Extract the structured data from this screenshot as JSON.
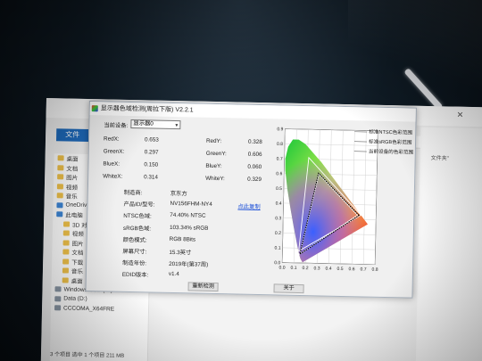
{
  "window": {
    "title": "显示器色域检测(周拉下版) V2.2.1",
    "monitor_label": "当前设备:",
    "monitor_value": "显示器0"
  },
  "coords": [
    {
      "label": "RedX:",
      "value": "0.653"
    },
    {
      "label": "RedY:",
      "value": "0.328"
    },
    {
      "label": "GreenX:",
      "value": "0.297"
    },
    {
      "label": "GreenY:",
      "value": "0.606"
    },
    {
      "label": "BlueX:",
      "value": "0.150"
    },
    {
      "label": "BlueY:",
      "value": "0.060"
    },
    {
      "label": "WhiteX:",
      "value": "0.314"
    },
    {
      "label": "WhiteY:",
      "value": "0.329"
    }
  ],
  "info": [
    {
      "label": "制造商:",
      "value": "京东方"
    },
    {
      "label": "产品ID/型号:",
      "value": "NV156FHM-NY4",
      "link": "点此复制"
    },
    {
      "label": "NTSC色域:",
      "value": "74.40% NTSC"
    },
    {
      "label": "sRGB色域:",
      "value": "103.34% sRGB"
    },
    {
      "label": "颜色模式:",
      "value": "RGB 8Bits"
    },
    {
      "label": "屏幕尺寸:",
      "value": "15.3英寸"
    },
    {
      "label": "制造年份:",
      "value": "2019年(第37周)"
    },
    {
      "label": "EDID版本:",
      "value": "v1.4"
    }
  ],
  "buttons": {
    "redetect": "重新检测",
    "close": "关于"
  },
  "legend": [
    "标准NTSC色彩范围",
    "标准sRGB色彩范围",
    "当前设备的色彩范围"
  ],
  "chart_data": {
    "type": "scatter",
    "title": "",
    "xlim": [
      0.0,
      0.8
    ],
    "ylim": [
      0.0,
      0.9
    ],
    "x_ticks": [
      "0.0",
      "0.1",
      "0.2",
      "0.3",
      "0.4",
      "0.5",
      "0.6",
      "0.7",
      "0.8"
    ],
    "y_ticks": [
      "0.0",
      "0.1",
      "0.2",
      "0.3",
      "0.4",
      "0.5",
      "0.6",
      "0.7",
      "0.8",
      "0.9"
    ],
    "grid": true,
    "series": [
      {
        "name": "标准NTSC色彩范围",
        "points": [
          [
            0.67,
            0.33
          ],
          [
            0.21,
            0.71
          ],
          [
            0.14,
            0.08
          ]
        ],
        "color": "#ffffff"
      },
      {
        "name": "标准sRGB色彩范围",
        "points": [
          [
            0.64,
            0.33
          ],
          [
            0.3,
            0.6
          ],
          [
            0.15,
            0.06
          ]
        ],
        "color": "#ffffff"
      },
      {
        "name": "当前设备的色彩范围",
        "points": [
          [
            0.653,
            0.328
          ],
          [
            0.297,
            0.606
          ],
          [
            0.15,
            0.06
          ]
        ],
        "color": "#000000"
      }
    ]
  },
  "explorer": {
    "tab": "文件",
    "nav": [
      "桌面",
      "文档",
      "图片",
      "视频",
      "音乐",
      "OneDrive",
      "此电脑",
      "3D 对象",
      "视频",
      "图片",
      "文档",
      "下载",
      "音乐",
      "桌面",
      "Windows-SSD (C:)",
      "Data (D:)",
      "CCCOMA_X64FRE"
    ],
    "status": "3 个项目   选中 1 个项目 211 MB",
    "hint": "文件夹\""
  }
}
